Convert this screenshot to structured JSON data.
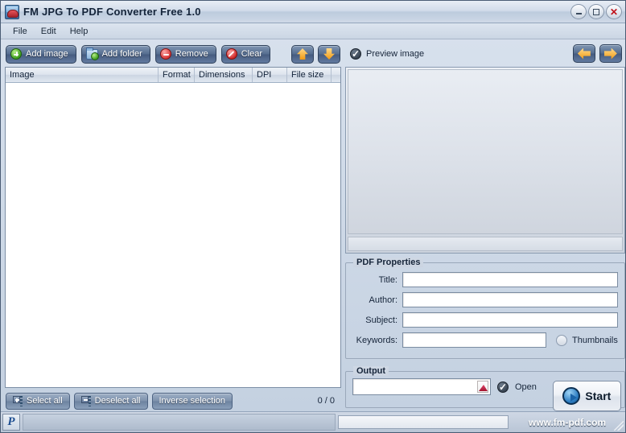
{
  "window": {
    "title": "FM JPG To PDF Converter Free 1.0",
    "icon": "app-photo-icon",
    "controls": {
      "minimize": "minimize-icon",
      "maximize": "maximize-icon",
      "close": "✕"
    }
  },
  "menubar": {
    "items": [
      {
        "label": "File"
      },
      {
        "label": "Edit"
      },
      {
        "label": "Help"
      }
    ]
  },
  "toolbar": {
    "buttons": [
      {
        "label": "Add image",
        "icon": "green-plus-circle-icon"
      },
      {
        "label": "Add folder",
        "icon": "folder-add-icon"
      },
      {
        "label": "Remove",
        "icon": "red-minus-circle-icon"
      },
      {
        "label": "Clear",
        "icon": "red-ban-circle-icon"
      }
    ],
    "move_up": "arrow-up-icon",
    "move_down": "arrow-down-icon"
  },
  "file_list": {
    "columns": [
      {
        "label": "Image"
      },
      {
        "label": "Format"
      },
      {
        "label": "Dimensions"
      },
      {
        "label": "DPI"
      },
      {
        "label": "File size"
      },
      {
        "label": ""
      }
    ],
    "rows": [],
    "counter": "0 / 0"
  },
  "selection_bar": {
    "select_all": "Select all",
    "deselect_all": "Deselect all",
    "inverse_selection": "Inverse selection"
  },
  "preview": {
    "checkbox_label": "Preview image",
    "checkbox_checked": true,
    "prev_icon": "arrow-left-icon",
    "next_icon": "arrow-right-icon"
  },
  "pdf_properties": {
    "title": "PDF Properties",
    "fields": [
      {
        "label": "Title:",
        "value": "",
        "placeholder": ""
      },
      {
        "label": "Author:",
        "value": "",
        "placeholder": ""
      },
      {
        "label": "Subject:",
        "value": "",
        "placeholder": ""
      },
      {
        "label": "Keywords:",
        "value": "",
        "placeholder": ""
      }
    ],
    "thumbnails": {
      "label": "Thumbnails",
      "checked": false
    }
  },
  "output": {
    "title": "Output",
    "path_value": "",
    "path_placeholder": "",
    "pdf_icon": "pdf-file-icon",
    "open_label": "Open",
    "open_checked": true,
    "start_label": "Start",
    "start_icon": "play-circle-icon"
  },
  "statusbar": {
    "paypal_icon": "P",
    "progress_value": 0,
    "site_url": "www.fm-pdf.com"
  },
  "colors": {
    "titlebar_text": "#14243a",
    "toolbar_button": "#465c80",
    "accent_orange": "#f09a12",
    "close_red": "#c0121a",
    "green": "#3f9e20",
    "red": "#d02a2a",
    "play_blue": "#2f7fc4"
  }
}
